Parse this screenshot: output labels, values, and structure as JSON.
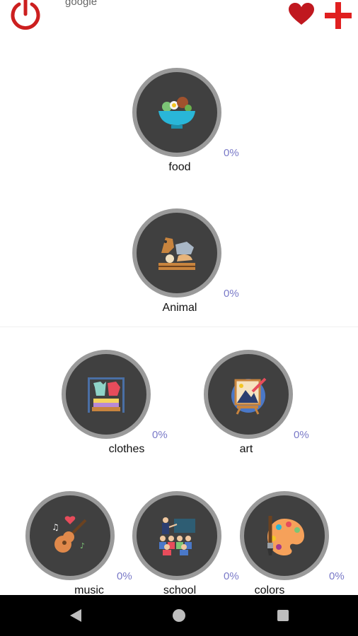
{
  "header": {
    "account_label": "google",
    "icons": {
      "power": "power-icon",
      "favorites": "heart-icon",
      "add": "plus-icon"
    },
    "accent_color": "#cc1f1f"
  },
  "categories": [
    {
      "label": "food",
      "progress": "0%",
      "icon": "salad-bowl-icon"
    },
    {
      "label": "Animal",
      "progress": "0%",
      "icon": "farm-animals-icon"
    },
    {
      "label": "clothes",
      "progress": "0%",
      "icon": "clothes-rack-icon"
    },
    {
      "label": "art",
      "progress": "0%",
      "icon": "easel-painting-icon"
    },
    {
      "label": "music",
      "progress": "0%",
      "icon": "guitar-icon"
    },
    {
      "label": "school",
      "progress": "0%",
      "icon": "classroom-icon"
    },
    {
      "label": "colors",
      "progress": "0%",
      "icon": "palette-icon"
    }
  ],
  "navbar": {
    "icons": [
      "back-icon",
      "home-icon",
      "recent-apps-icon"
    ]
  }
}
